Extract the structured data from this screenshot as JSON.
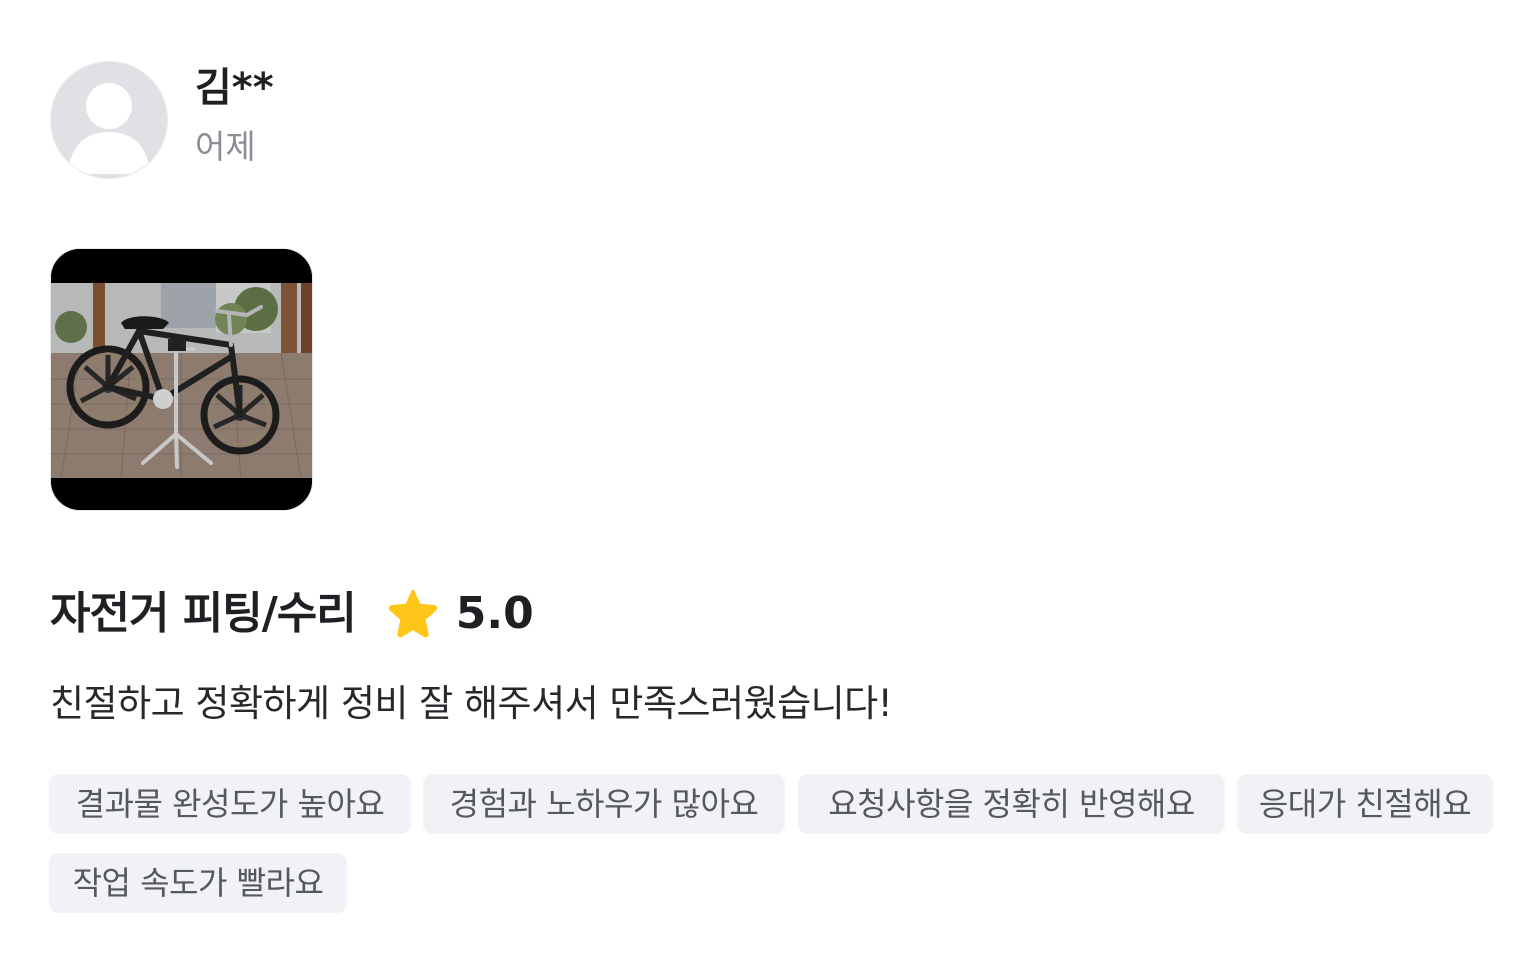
{
  "reviewer": {
    "name": "김**",
    "date": "어제",
    "avatar_icon": "default-user-avatar-icon"
  },
  "photo": {
    "alt": "bicycle-on-repair-stand-photo"
  },
  "service": {
    "name": "자전거 피팅/수리",
    "rating": "5.0",
    "star_color": "#ffc61a"
  },
  "review": {
    "text": "친절하고 정확하게 정비 잘 해주셔서 만족스러웠습니다!"
  },
  "tags": [
    "결과물 완성도가 높아요",
    "경험과 노하우가 많아요",
    "요청사항을 정확히 반영해요",
    "응대가 친절해요",
    "작업 속도가 빨라요"
  ],
  "colors": {
    "text_primary": "#1f2024",
    "text_secondary": "#8a8d93",
    "tag_bg": "#f1f2f5",
    "tag_text": "#55585f"
  }
}
